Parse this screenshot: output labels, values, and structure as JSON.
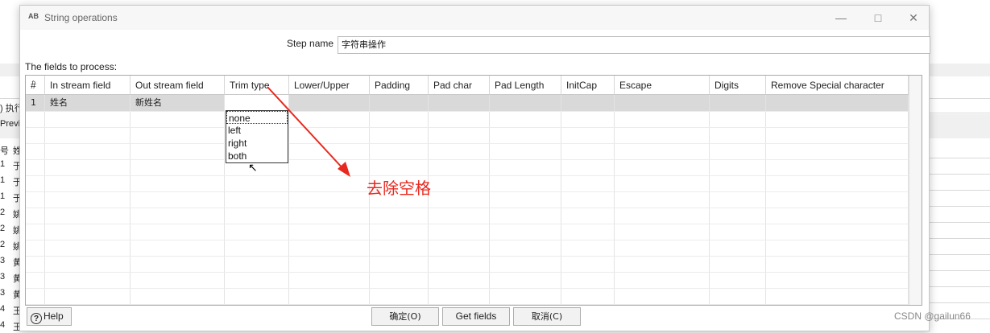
{
  "background": {
    "run_label": ") 执行",
    "preview_label": "Previe",
    "col_labels": [
      "号",
      "姓"
    ],
    "rows": [
      {
        "num": "1",
        "name": "于"
      },
      {
        "num": "1",
        "name": "于"
      },
      {
        "num": "1",
        "name": "于"
      },
      {
        "num": "2",
        "name": "姚"
      },
      {
        "num": "2",
        "name": "姚"
      },
      {
        "num": "2",
        "name": "姚"
      },
      {
        "num": "3",
        "name": "黄"
      },
      {
        "num": "3",
        "name": "黄"
      },
      {
        "num": "3",
        "name": "黄"
      },
      {
        "num": "4",
        "name": "王"
      },
      {
        "num": "4",
        "name": "王"
      }
    ]
  },
  "dialog": {
    "title_icon": "AB",
    "title": "String operations",
    "step_name_label": "Step name",
    "step_name_value": "字符串操作",
    "fields_label": "The fields to process:"
  },
  "table": {
    "headers": [
      "#",
      "In stream field",
      "Out stream field",
      "Trim type",
      "Lower/Upper",
      "Padding",
      "Pad char",
      "Pad Length",
      "InitCap",
      "Escape",
      "Digits",
      "Remove Special character"
    ],
    "rows": [
      {
        "num": "1",
        "in_field": "姓名",
        "out_field": "新姓名"
      }
    ]
  },
  "dropdown": {
    "options": [
      "none",
      "left",
      "right",
      "both"
    ],
    "highlighted": "none"
  },
  "buttons": {
    "help": "Help",
    "ok": "确定(O)",
    "get_fields": "Get fields",
    "cancel": "取消(C)"
  },
  "annotation": {
    "text": "去除空格",
    "color": "#e8281e"
  },
  "watermark": "CSDN @gailun66"
}
